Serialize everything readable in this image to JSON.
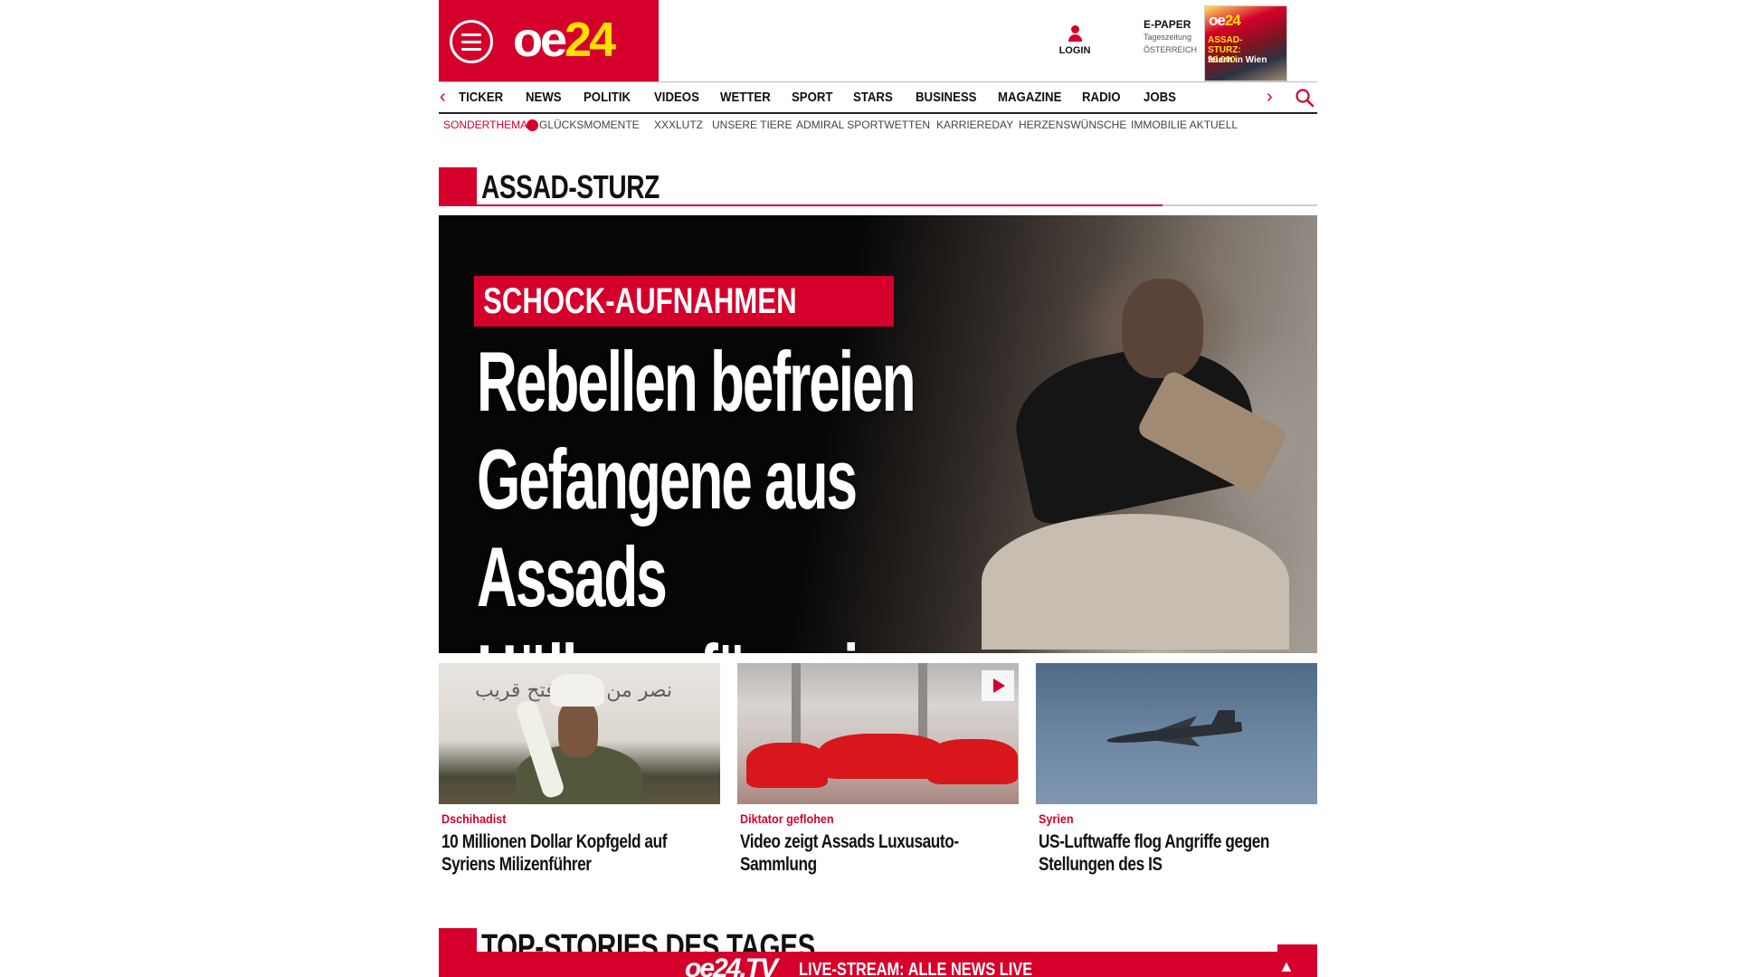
{
  "header": {
    "logo_oe": "oe",
    "logo_num": "24",
    "login_label": "LOGIN",
    "epaper_title": "E-PAPER",
    "epaper_sub1": "Tageszeitung",
    "epaper_sub2": "ÖSTERREICH",
    "epaper_cover_logo_oe": "oe",
    "epaper_cover_logo_num": "24",
    "epaper_cover_headline": "ASSAD-STURZ: 30.000",
    "epaper_cover_headline2": "feiern in Wien"
  },
  "nav": {
    "items": [
      "TICKER",
      "NEWS",
      "POLITIK",
      "VIDEOS",
      "WETTER",
      "SPORT",
      "STARS",
      "BUSINESS",
      "MAGAZINE",
      "RADIO",
      "JOBS"
    ],
    "left_arrow": "‹",
    "right_arrow": "›"
  },
  "subnav": {
    "lead": "SONDERTHEMA:",
    "items": [
      "GLÜCKSMOMENTE",
      "XXXLUTZ",
      "UNSERE TIERE",
      "ADMIRAL SPORTWETTEN",
      "KARRIEREDAY",
      "HERZENSWÜNSCHE",
      "IMMOBILIE AKTUELL"
    ]
  },
  "section": {
    "title": "ASSAD-STURZ"
  },
  "hero": {
    "kicker": "SCHOCK-AUFNAHMEN",
    "title_line1": "Rebellen befreien",
    "title_line2": "Gefangene aus",
    "title_line3": "Assads Höllengefängnis"
  },
  "cards": [
    {
      "kicker": "Dschihadist",
      "title": "10 Millionen Dollar Kopfgeld auf Syriens Milizenführer",
      "image_text": "نصر من الله وفتح قريب"
    },
    {
      "kicker": "Diktator geflohen",
      "title": "Video zeigt Assads Luxusauto-Sammlung",
      "has_video": true
    },
    {
      "kicker": "Syrien",
      "title": "US-Luftwaffe flog Angriffe gegen Stellungen des IS"
    }
  ],
  "top_stories": {
    "title": "TOP-STORIES DES TAGES"
  },
  "live_bar": {
    "logo": "oe24.TV",
    "text": "LIVE-STREAM: ALLE NEWS LIVE",
    "up_arrow": "▲"
  },
  "colors": {
    "brand_red": "#d4002b",
    "logo_yellow": "#ffe000"
  }
}
